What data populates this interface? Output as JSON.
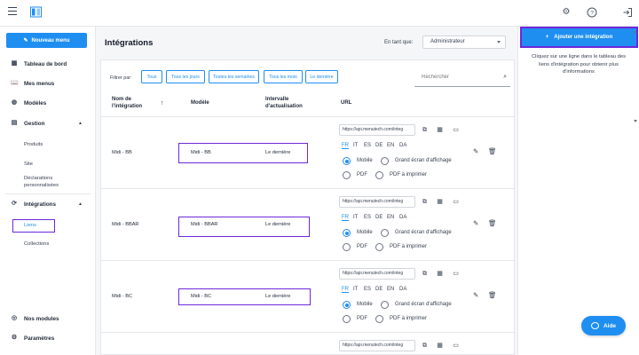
{
  "sidebar": {
    "new_menu": "Nouveau menu",
    "items": {
      "dashboard": "Tableau de bord",
      "menus": "Mes menus",
      "models": "Modèles",
      "management": "Gestion",
      "products": "Produits",
      "site": "Site",
      "declarations_1": "Déclarations",
      "declarations_2": "personnalisées",
      "integrations": "Intégrations",
      "links": "Liens",
      "collections": "Collections",
      "modules": "Nos modules",
      "settings": "Paramètres"
    }
  },
  "main": {
    "title": "Intégrations",
    "role_label": "En tant que:",
    "role_value": "Administrateur",
    "filter_label": "Filtrer par:",
    "filters": [
      "Tous",
      "Tous les jours",
      "Toutes les semaines",
      "Tous les mois",
      "Le dernière"
    ],
    "search_placeholder": "Rechercher",
    "columns": {
      "name_1": "Nom de",
      "name_2": "l'intégration",
      "sort_arrow": "↑",
      "model": "Modèle",
      "interval_1": "Intervalle",
      "interval_2": "d'actualisation",
      "url": "URL"
    },
    "rows": [
      {
        "name": "Midi - BB",
        "model": "Midi - BB",
        "interval": "Le dernière",
        "url": "https://api.menutech.com/integ"
      },
      {
        "name": "Midi - BBAR",
        "model": "Midi - BBAR",
        "interval": "Le dernière",
        "url": "https://api.menutech.com/integ"
      },
      {
        "name": "Midi - BC",
        "model": "Midi - BC",
        "interval": "Le dernière",
        "url": "https://api.menutech.com/integ"
      },
      {
        "url": "https://api.menutech.com/integ"
      }
    ],
    "languages": [
      "FR",
      "IT",
      "ES",
      "DE",
      "EN",
      "DA"
    ],
    "options": {
      "mobile": "Mobile",
      "big_screen": "Grand écran d'affichage",
      "pdf": "PDF",
      "pdf_print": "PDF à imprimer"
    }
  },
  "right_panel": {
    "add_button": "Ajouter une intégration",
    "hint": "Cliquez sur une ligne dans le tableau des liens d'intégration pour obtenir plus d'informations"
  },
  "help": {
    "label": "Aide"
  },
  "colors": {
    "accent": "#1f8ef1",
    "highlight": "#6d28d9"
  }
}
